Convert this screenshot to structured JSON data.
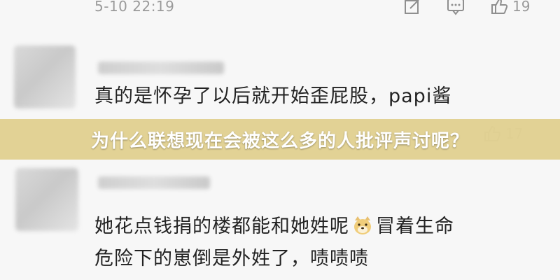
{
  "comment1": {
    "timestamp": "5-10 22:19",
    "like_count": "19",
    "icons": [
      "share-icon",
      "comment-icon",
      "thumbs-up-icon"
    ]
  },
  "comment2": {
    "text_line1": "真的是怀孕了以后就开始歪屁股，papi酱",
    "like_count": "17"
  },
  "banner": {
    "title": "为什么联想现在会被这么多的人批评声讨呢？",
    "background": "#e0ce8c"
  },
  "comment3": {
    "text_line1_a": "她花点钱捐的楼都能和她姓呢",
    "emoji": "doge-emoji",
    "text_line1_b": "冒着生命",
    "text_line2": "危险下的崽倒是外姓了，啧啧啧"
  }
}
